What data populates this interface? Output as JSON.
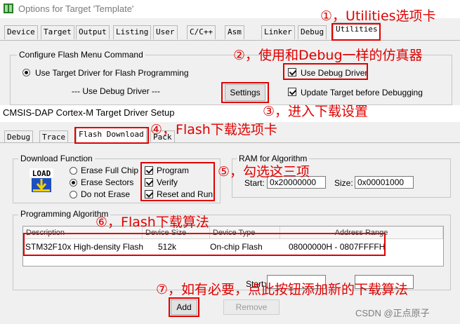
{
  "window1": {
    "title": "Options for Target 'Template'",
    "tabs": [
      "Device",
      "Target",
      "Output",
      "Listing",
      "User",
      "C/C++",
      "Asm",
      "Linker",
      "Debug",
      "Utilities"
    ],
    "active_tab": "Utilities",
    "group_title": "Configure Flash Menu Command",
    "radio_label": "Use Target Driver for Flash Programming",
    "use_debug_driver_dropdown": "--- Use Debug Driver ---",
    "settings_button": "Settings",
    "use_debug_driver_check": "Use Debug Driver",
    "update_target_check": "Update Target before Debugging"
  },
  "window2": {
    "title": "CMSIS-DAP Cortex-M Target Driver Setup",
    "tabs": [
      "Debug",
      "Trace",
      "Flash Download",
      "Pack"
    ],
    "active_tab": "Flash Download",
    "download_function": {
      "title": "Download Function",
      "icon_text": "LOAD",
      "radios": [
        "Erase Full Chip",
        "Erase Sectors",
        "Do not Erase"
      ],
      "checks": [
        "Program",
        "Verify",
        "Reset and Run"
      ]
    },
    "ram": {
      "title": "RAM for Algorithm",
      "start_label": "Start:",
      "start_value": "0x20000000",
      "size_label": "Size:",
      "size_value": "0x00001000"
    },
    "algorithm": {
      "title": "Programming Algorithm",
      "columns": [
        "Description",
        "Device Size",
        "Device Type",
        "Address Range"
      ],
      "rows": [
        {
          "description": "STM32F10x High-density Flash",
          "size": "512k",
          "type": "On-chip Flash",
          "range": "08000000H - 0807FFFFH"
        }
      ],
      "start_label": "Start:",
      "add_button": "Add",
      "remove_button": "Remove"
    }
  },
  "annotations": {
    "a1": "①，Utilities选项卡",
    "a2": "②，使用和Debug一样的仿真器",
    "a3": "③，进入下载设置",
    "a4": "④，Flash下载选项卡",
    "a5": "⑤，勾选这三项",
    "a6": "⑥，Flash下载算法",
    "a7": "⑦，如有必要，点此按钮添加新的下载算法"
  },
  "watermark": "CSDN @正点原子",
  "colors": {
    "annotation_red": "#e00000",
    "window_bg": "#f0f0f0",
    "icon_blue": "#1e4fc2",
    "icon_yellow": "#f5d000"
  }
}
